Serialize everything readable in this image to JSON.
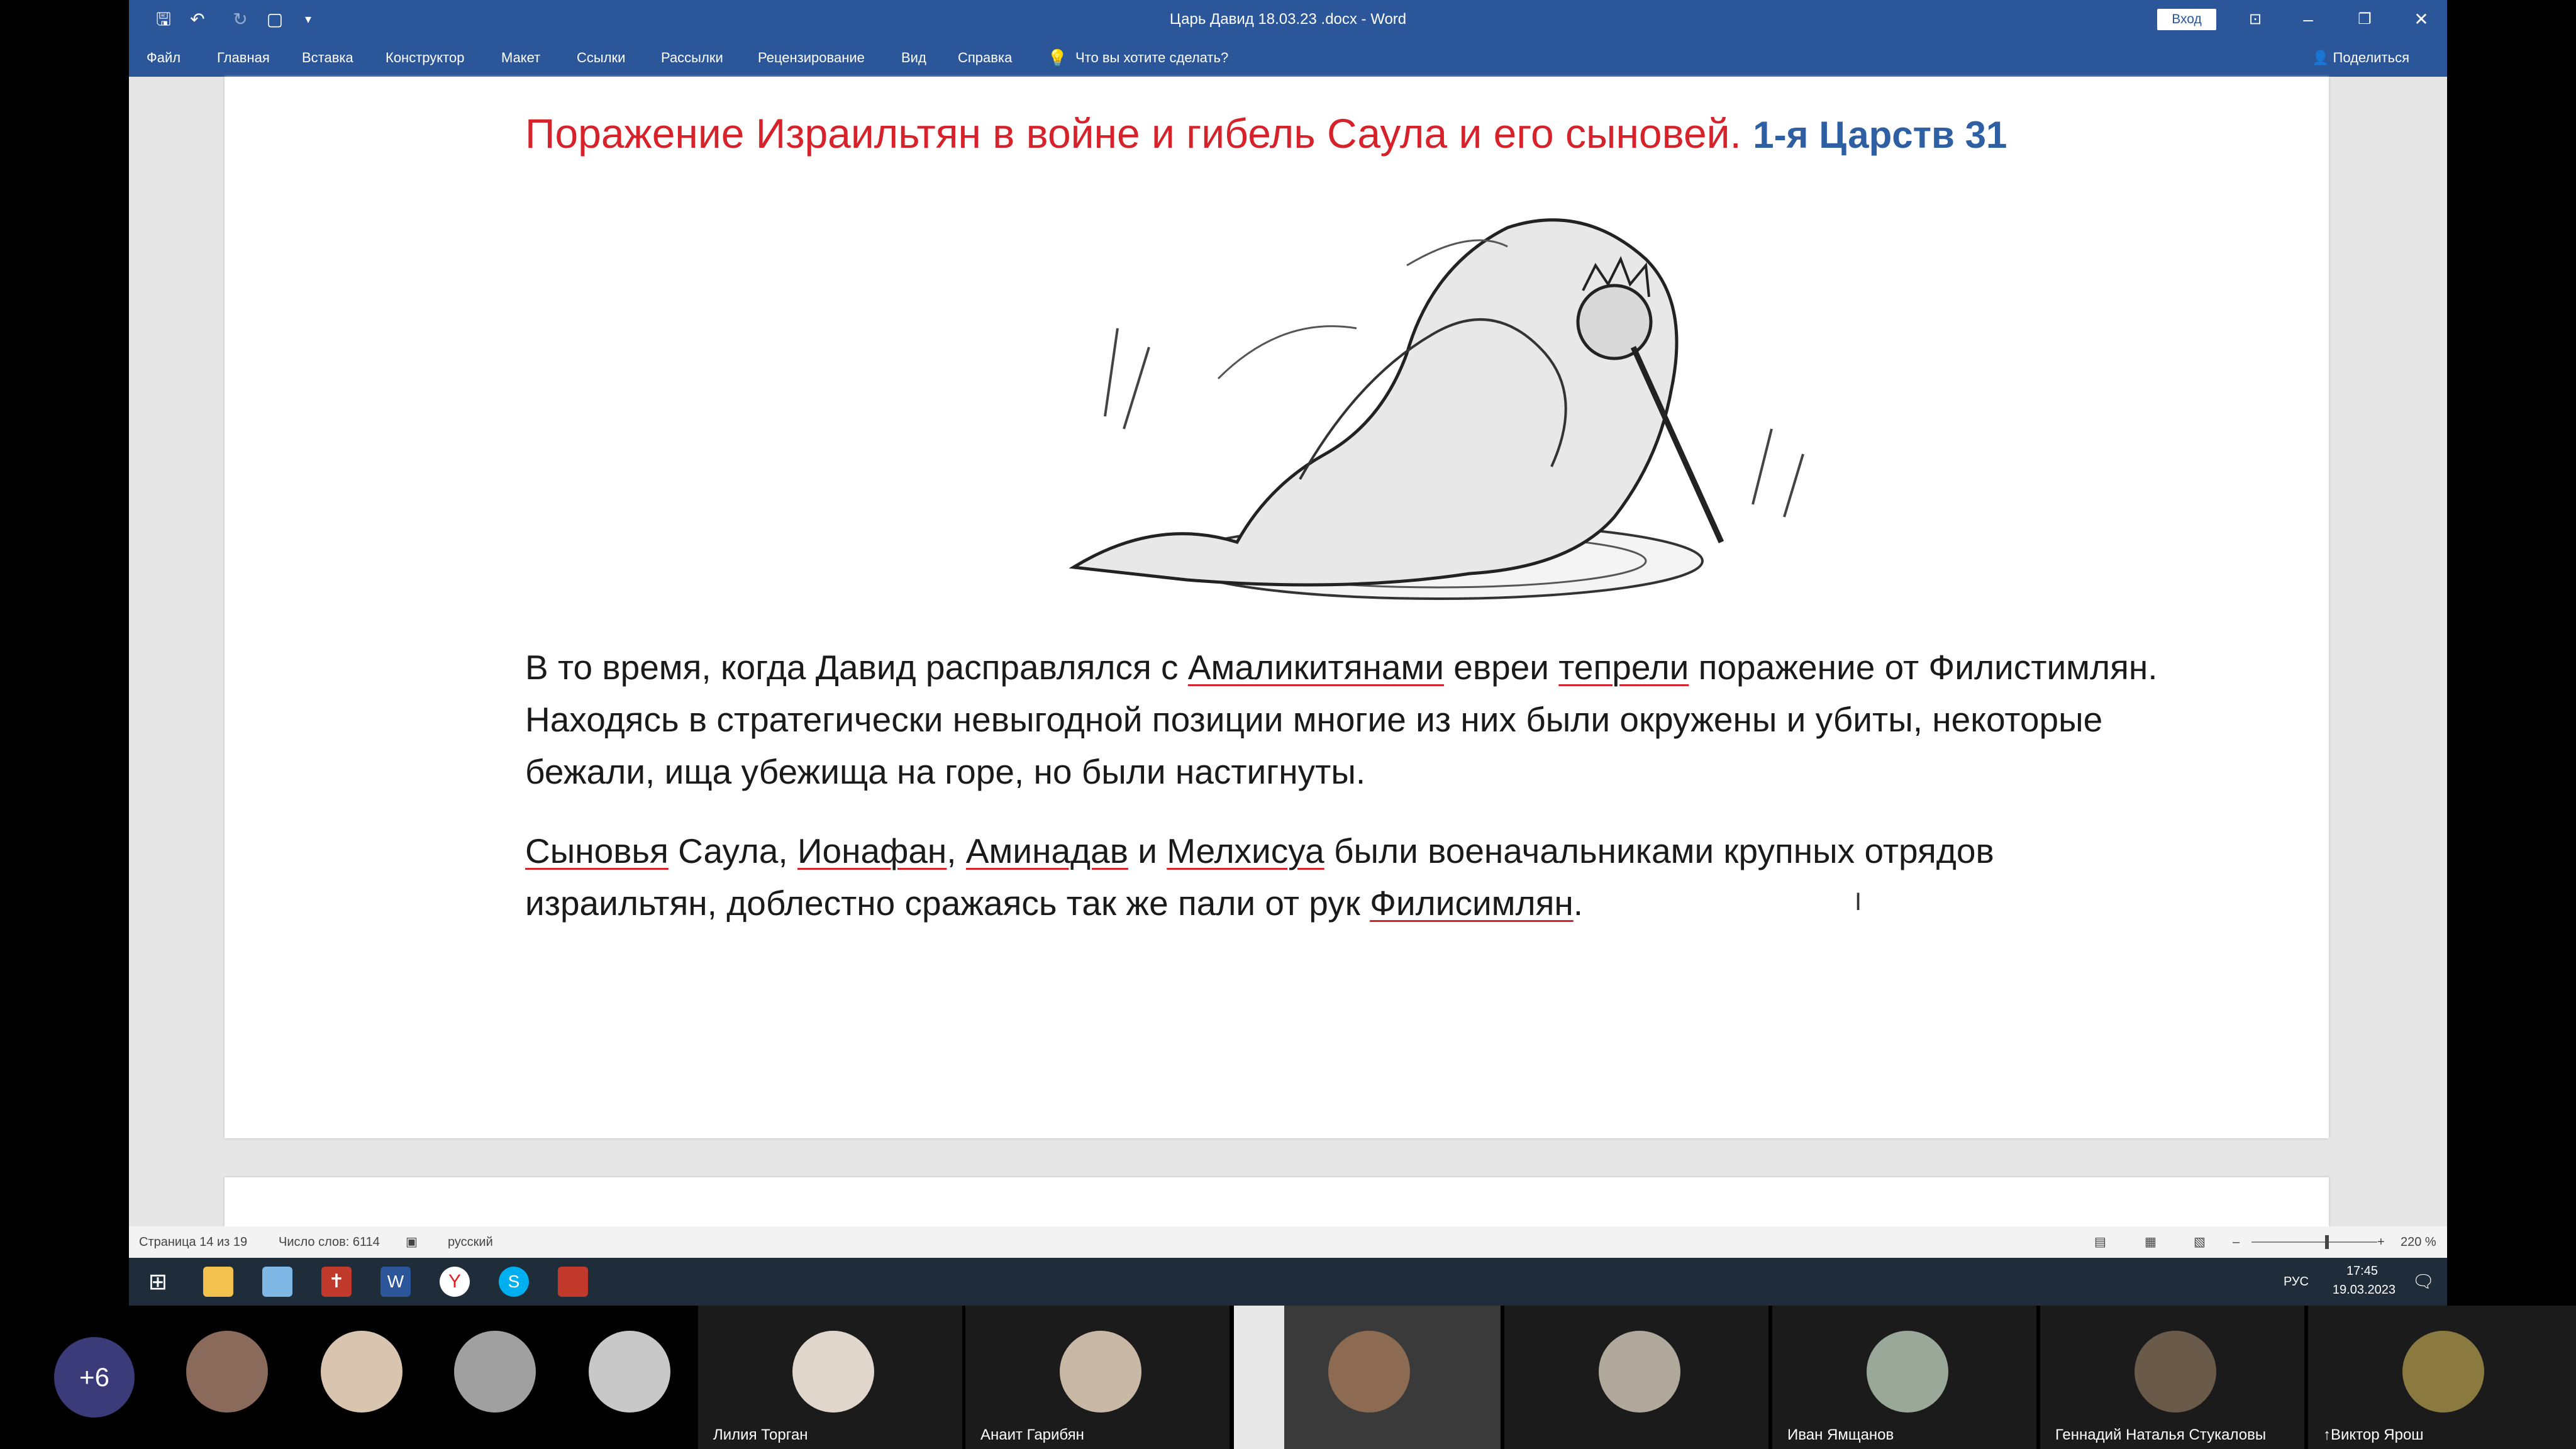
{
  "window": {
    "title": "Царь Давид 18.03.23 .docx  -  Word",
    "login_label": "Вход",
    "share_label": "Поделиться",
    "tell_me": "Что вы хотите сделать?"
  },
  "ribbon_tabs": [
    "Файл",
    "Главная",
    "Вставка",
    "Конструктор",
    "Макет",
    "Ссылки",
    "Рассылки",
    "Рецензирование",
    "Вид",
    "Справка"
  ],
  "document": {
    "heading": "Поражение Израильтян в войне и гибель Саула и его сыновей.",
    "heading_ref": "1-я Царств 31",
    "p1": [
      "В то время, когда Давид расправлялся с ",
      "Амаликитянами",
      " евреи ",
      "тепрели",
      " поражение от Филистимлян. Находясь в стратегически невыгодной позиции многие из них были окружены и убиты, некоторые бежали, ища убежища на горе, но были настигнуты."
    ],
    "p2": [
      "Сыновья",
      " Саула, ",
      "Ионафан",
      ", ",
      "Аминадав",
      " и ",
      "Мелхисуа",
      " были военачальниками крупных отрядов израильтян, доблестно сражаясь так же пали от рук ",
      "Филисимлян",
      "."
    ]
  },
  "statusbar": {
    "page": "Страница 14 из 19",
    "words": "Число слов: 6114",
    "language": "русский",
    "zoom": "220 %"
  },
  "taskbar": {
    "lang": "РУС",
    "time": "17:45",
    "date": "19.03.2023"
  },
  "participants": {
    "more": "+6",
    "named": [
      "Лилия Торган",
      "Анаит Гарибян",
      "Иван Ямщанов",
      "Геннадий Наталья Стукаловы",
      "↑Виктор Ярош"
    ]
  }
}
